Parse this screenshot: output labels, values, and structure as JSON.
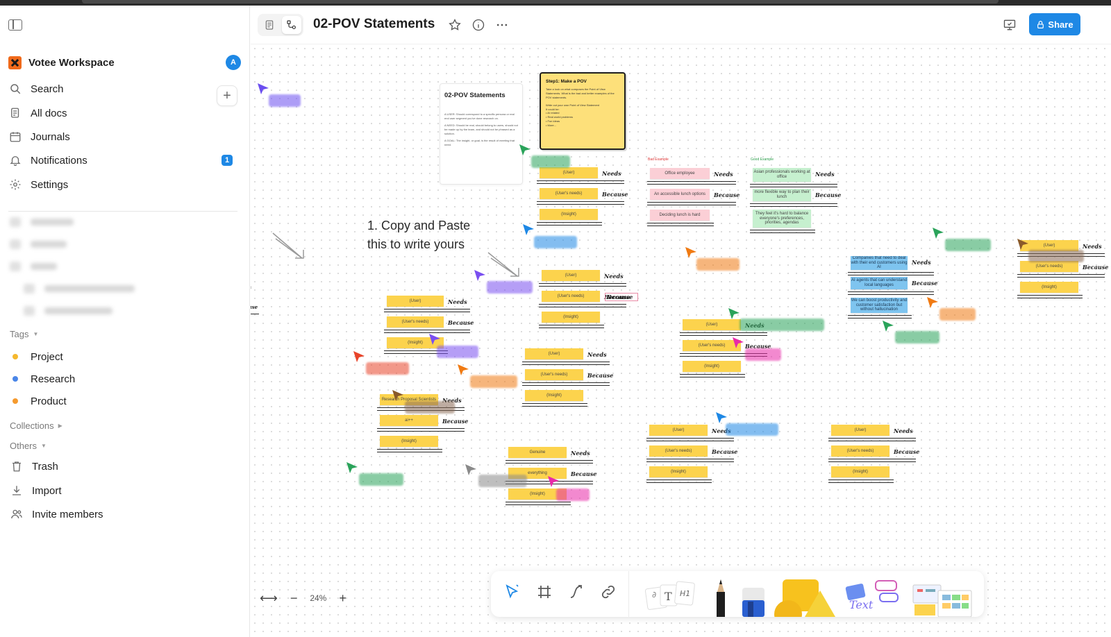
{
  "workspace": {
    "name": "Votee Workspace",
    "avatar_initial": "A"
  },
  "nav": {
    "search": "Search",
    "all_docs": "All docs",
    "journals": "Journals",
    "notifications": "Notifications",
    "notifications_count": "1",
    "settings": "Settings"
  },
  "sections": {
    "tags": "Tags",
    "collections": "Collections",
    "others": "Others"
  },
  "tags": [
    {
      "label": "Project",
      "color": "#f5b82e"
    },
    {
      "label": "Research",
      "color": "#4a86e8"
    },
    {
      "label": "Product",
      "color": "#f59a2e"
    }
  ],
  "others": {
    "trash": "Trash",
    "import": "Import",
    "invite": "Invite members"
  },
  "header": {
    "title": "02-POV Statements",
    "share": "Share"
  },
  "canvas": {
    "doc_card": {
      "title": "02-POV Statements",
      "user": "A USER: Should correspond to a specific persona or real end user segment you've done research on.",
      "need": "A NEED: Should be real, should belong to users, should not be made up by the team, and should not be phrased as a solution.",
      "goal": "A GOAL: The insight, or goal, is the result of meeting that need."
    },
    "step_card": {
      "title": "Step1: Make a POV",
      "intro": "Take a look on what composes the Point of View Statements. What is the bad and better examples of the POV statements.",
      "write": "Write out your own Point of View Statement",
      "could_be": "It could be:",
      "bullets": [
        "AI related",
        "Real world problems",
        "Fun ideas",
        "More..."
      ]
    },
    "copy_paste_line1": "1. Copy and Paste",
    "copy_paste_line2": "this to write yours",
    "needs": "Needs",
    "because": "Because",
    "user": "(User)",
    "users_needs": "(User's needs)",
    "insight": "(Insight)",
    "bad_example": "Bad Example",
    "good_example": "Good Example",
    "bad_rows": [
      "Office employee",
      "An accessible lunch options",
      "Deciding lunch is hard"
    ],
    "good_rows": [
      "Asian professionals working at office",
      "more flexible way to plan their lunch",
      "They feel it's hard to balance everyone's preferences, priorities, agendas"
    ],
    "blue_rows": [
      "Companies that need to deal with their end customers using AI",
      "AI agents that can understand local languages",
      "We can boost productivity and customer satisfaction but without hallucination"
    ],
    "research_row": "Research Proposal Scientists",
    "ai_row": "ai++",
    "genuine_row": "Genuine",
    "everything_row": "everything"
  },
  "zoom": {
    "level": "24%"
  },
  "colors": {
    "accent": "#1e88e5",
    "sticky_yellow": "#fcd34d"
  }
}
